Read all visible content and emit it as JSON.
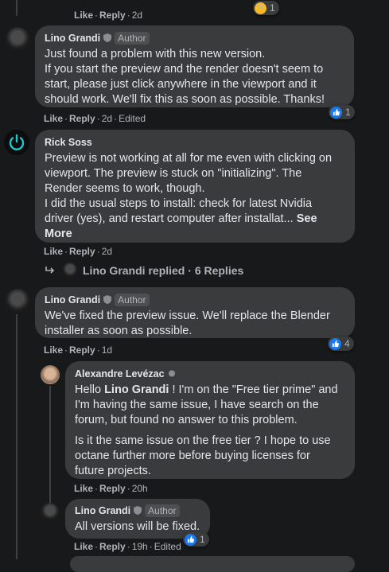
{
  "comments": [
    {
      "id": "c0",
      "meta": {
        "like": "Like",
        "reply": "Reply",
        "time": "2d"
      },
      "reactions": {
        "count": "1",
        "icon": "hugging-face-emoji"
      }
    },
    {
      "id": "c1",
      "author": "Lino Grandi",
      "badge": "Author",
      "lines": [
        "Just found a problem with this new version.",
        "If you start the preview and the render doesn't seem to",
        "start, please just click anywhere in the viewport and it",
        "should work. We'll fix this as soon as possible. Thanks!"
      ],
      "meta": {
        "like": "Like",
        "reply": "Reply",
        "time": "2d",
        "edited": "Edited"
      },
      "reactions": {
        "count": "1",
        "icon": "like-icon"
      }
    },
    {
      "id": "c2",
      "author": "Rick Soss",
      "lines": [
        "Preview is not working at all for me even with clicking on",
        "viewport. The preview is stuck on \"initializing\". The",
        "Render seems to work, though.",
        "I did the usual steps to install: check for latest Nvidia"
      ],
      "last_line": "driver (yes), and restart computer after installat...",
      "see_more_1": "See",
      "see_more_2": "More",
      "meta": {
        "like": "Like",
        "reply": "Reply",
        "time": "2d"
      },
      "replies_link": {
        "name": "Lino Grandi",
        "text": "replied",
        "count": "6 Replies"
      }
    },
    {
      "id": "c3",
      "author": "Lino Grandi",
      "badge": "Author",
      "lines": [
        "We've fixed the preview issue. We'll replace the Blender",
        "installer as soon as possible."
      ],
      "meta": {
        "like": "Like",
        "reply": "Reply",
        "time": "1d"
      },
      "reactions": {
        "count": "4",
        "icon": "like-icon"
      }
    },
    {
      "id": "c4",
      "author": "Alexandre Levézac",
      "mention": "Lino Grandi",
      "first_line_before": "Hello",
      "first_line_after": "! I'm on the \"Free tier prime\" and",
      "lines": [
        "I'm having the same issue, I have search on the",
        "forum, but found no answer to this problem."
      ],
      "para2": [
        "Is it the same issue on the free tier ? I hope to use",
        "octane further more before buying licenses for",
        "future projects."
      ],
      "meta": {
        "like": "Like",
        "reply": "Reply",
        "time": "20h"
      }
    },
    {
      "id": "c5",
      "author": "Lino Grandi",
      "badge": "Author",
      "lines": [
        "All versions will be fixed."
      ],
      "meta": {
        "like": "Like",
        "reply": "Reply",
        "time": "19h",
        "edited": "Edited"
      },
      "reactions": {
        "count": "1",
        "icon": "like-icon"
      }
    }
  ],
  "colors": {
    "background": "#18191a",
    "bubble": "#3a3b3c",
    "text": "#e4e6eb",
    "secondary": "#b0b3b8",
    "like_blue": "#1877f2"
  }
}
